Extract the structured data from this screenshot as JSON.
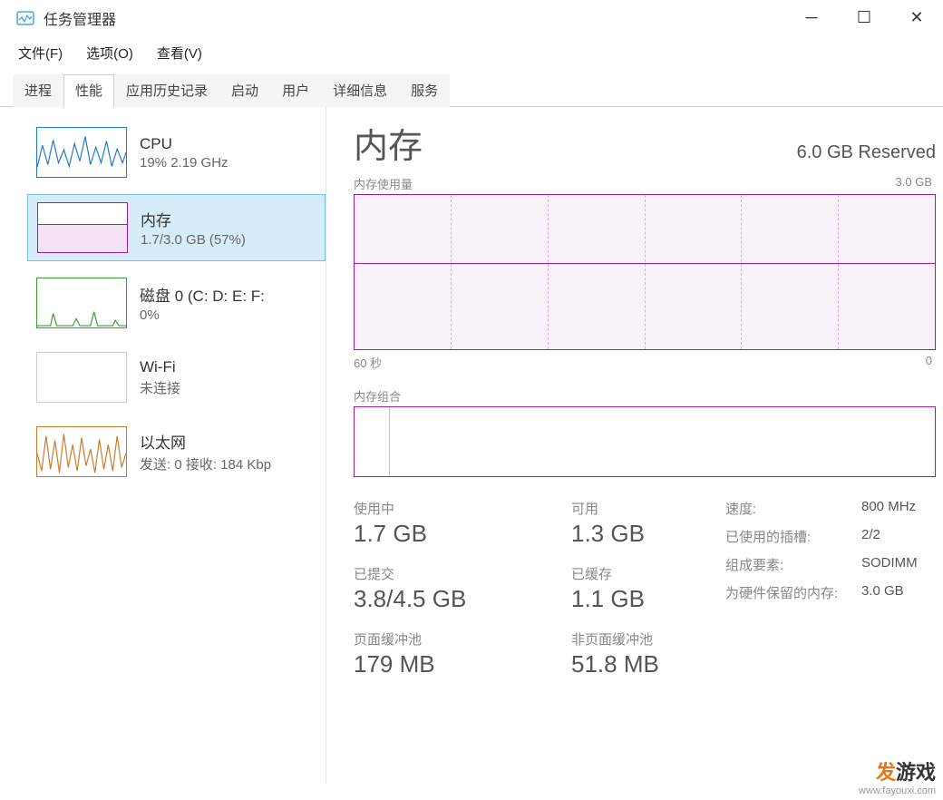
{
  "window": {
    "title": "任务管理器"
  },
  "menus": {
    "file": "文件(F)",
    "options": "选项(O)",
    "view": "查看(V)"
  },
  "tabs": {
    "processes": "进程",
    "performance": "性能",
    "history": "应用历史记录",
    "startup": "启动",
    "users": "用户",
    "details": "详细信息",
    "services": "服务"
  },
  "sidebar": {
    "cpu": {
      "title": "CPU",
      "subtitle": "19% 2.19 GHz"
    },
    "memory": {
      "title": "内存",
      "subtitle": "1.7/3.0 GB (57%)"
    },
    "disk": {
      "title": "磁盘 0 (C: D: E: F:",
      "subtitle": "0%"
    },
    "wifi": {
      "title": "Wi-Fi",
      "subtitle": "未连接"
    },
    "ethernet": {
      "title": "以太网",
      "subtitle": "发送: 0 接收: 184 Kbp"
    }
  },
  "main": {
    "title": "内存",
    "reserved": "6.0 GB Reserved",
    "chart_label": "内存使用量",
    "chart_max": "3.0 GB",
    "timeline_left": "60 秒",
    "timeline_right": "0",
    "comp_label": "内存组合",
    "stats": {
      "in_use_label": "使用中",
      "in_use": "1.7 GB",
      "available_label": "可用",
      "available": "1.3 GB",
      "committed_label": "已提交",
      "committed": "3.8/4.5 GB",
      "cached_label": "已缓存",
      "cached": "1.1 GB",
      "paged_label": "页面缓冲池",
      "paged": "179 MB",
      "nonpaged_label": "非页面缓冲池",
      "nonpaged": "51.8 MB"
    },
    "info": {
      "speed_label": "速度:",
      "speed": "800 MHz",
      "slots_label": "已使用的插槽:",
      "slots": "2/2",
      "form_label": "组成要素:",
      "form": "SODIMM",
      "hw_reserved_label": "为硬件保留的内存:",
      "hw_reserved": "3.0 GB"
    }
  },
  "watermark": {
    "brand_fa": "发",
    "brand_rest": "游戏",
    "url": "www.fayouxi.com"
  },
  "chart_data": {
    "type": "line",
    "title": "内存使用量",
    "xlabel": "60 秒 → 0",
    "ylabel": "GB",
    "ylim": [
      0,
      3.0
    ],
    "series": [
      {
        "name": "内存",
        "values": [
          1.68,
          1.68,
          1.69,
          1.69,
          1.68,
          1.68,
          1.7,
          1.69,
          1.68,
          1.68,
          1.7,
          1.7,
          1.69,
          1.68,
          1.7,
          1.7
        ]
      }
    ]
  }
}
